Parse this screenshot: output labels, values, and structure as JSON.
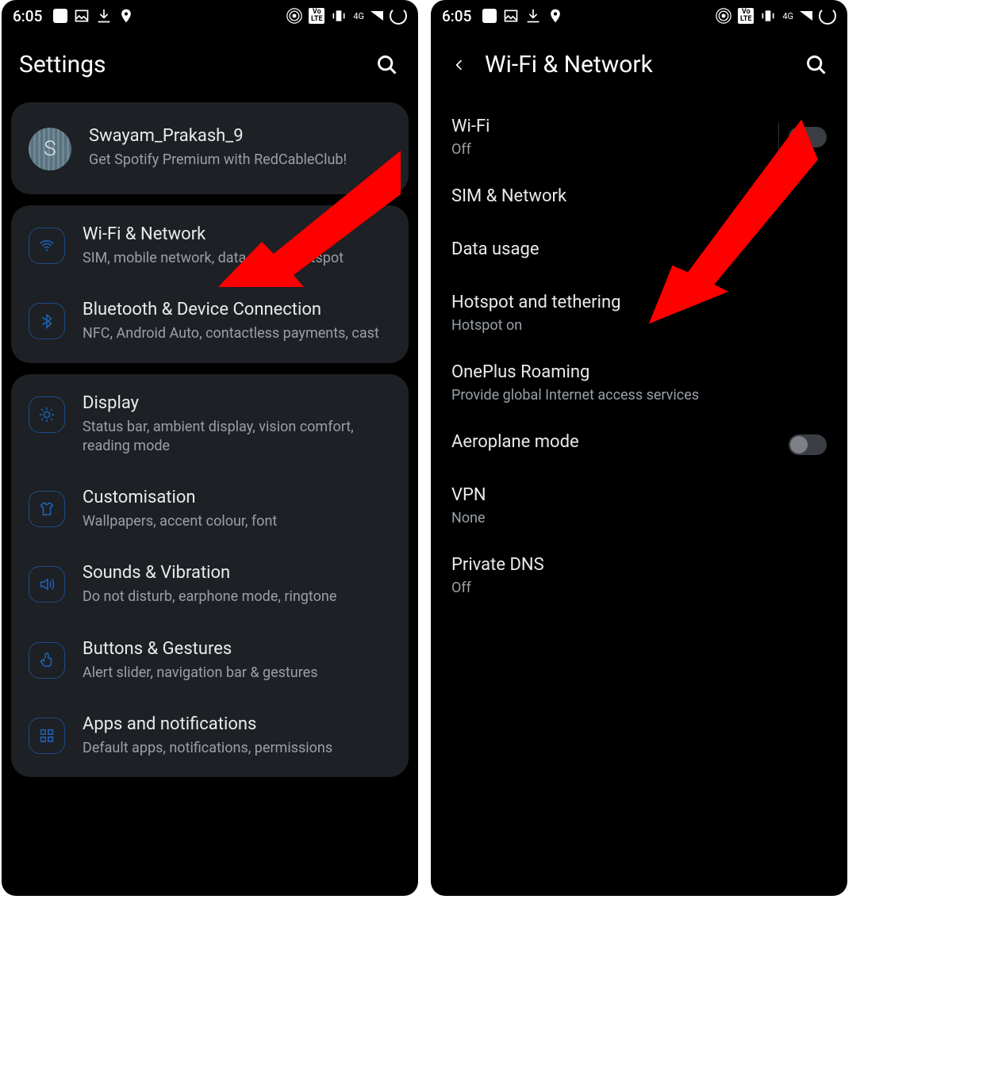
{
  "statusbar": {
    "time": "6:05",
    "signal_label": "4G"
  },
  "left": {
    "header_title": "Settings",
    "profile": {
      "initial": "S",
      "name": "Swayam_Prakash_9",
      "subtitle": "Get Spotify Premium with RedCableClub!"
    },
    "group1": [
      {
        "title": "Wi-Fi & Network",
        "sub": "SIM, mobile network, data usage, hotspot"
      },
      {
        "title": "Bluetooth & Device Connection",
        "sub": "NFC, Android Auto, contactless payments, cast"
      }
    ],
    "group2": [
      {
        "title": "Display",
        "sub": "Status bar, ambient display, vision comfort, reading mode"
      },
      {
        "title": "Customisation",
        "sub": "Wallpapers, accent colour, font"
      },
      {
        "title": "Sounds & Vibration",
        "sub": "Do not disturb, earphone mode, ringtone"
      },
      {
        "title": "Buttons & Gestures",
        "sub": "Alert slider, navigation bar & gestures"
      },
      {
        "title": "Apps and notifications",
        "sub": "Default apps, notifications, permissions"
      }
    ]
  },
  "right": {
    "header_title": "Wi-Fi & Network",
    "items": [
      {
        "title": "Wi-Fi",
        "sub": "Off",
        "toggle": true,
        "separated": true
      },
      {
        "title": "SIM & Network",
        "sub": ""
      },
      {
        "title": "Data usage",
        "sub": ""
      },
      {
        "title": "Hotspot and tethering",
        "sub": "Hotspot on"
      },
      {
        "title": "OnePlus Roaming",
        "sub": "Provide global Internet access services"
      },
      {
        "title": "Aeroplane mode",
        "sub": "",
        "toggle": true
      },
      {
        "title": "VPN",
        "sub": "None"
      },
      {
        "title": "Private DNS",
        "sub": "Off"
      }
    ]
  }
}
